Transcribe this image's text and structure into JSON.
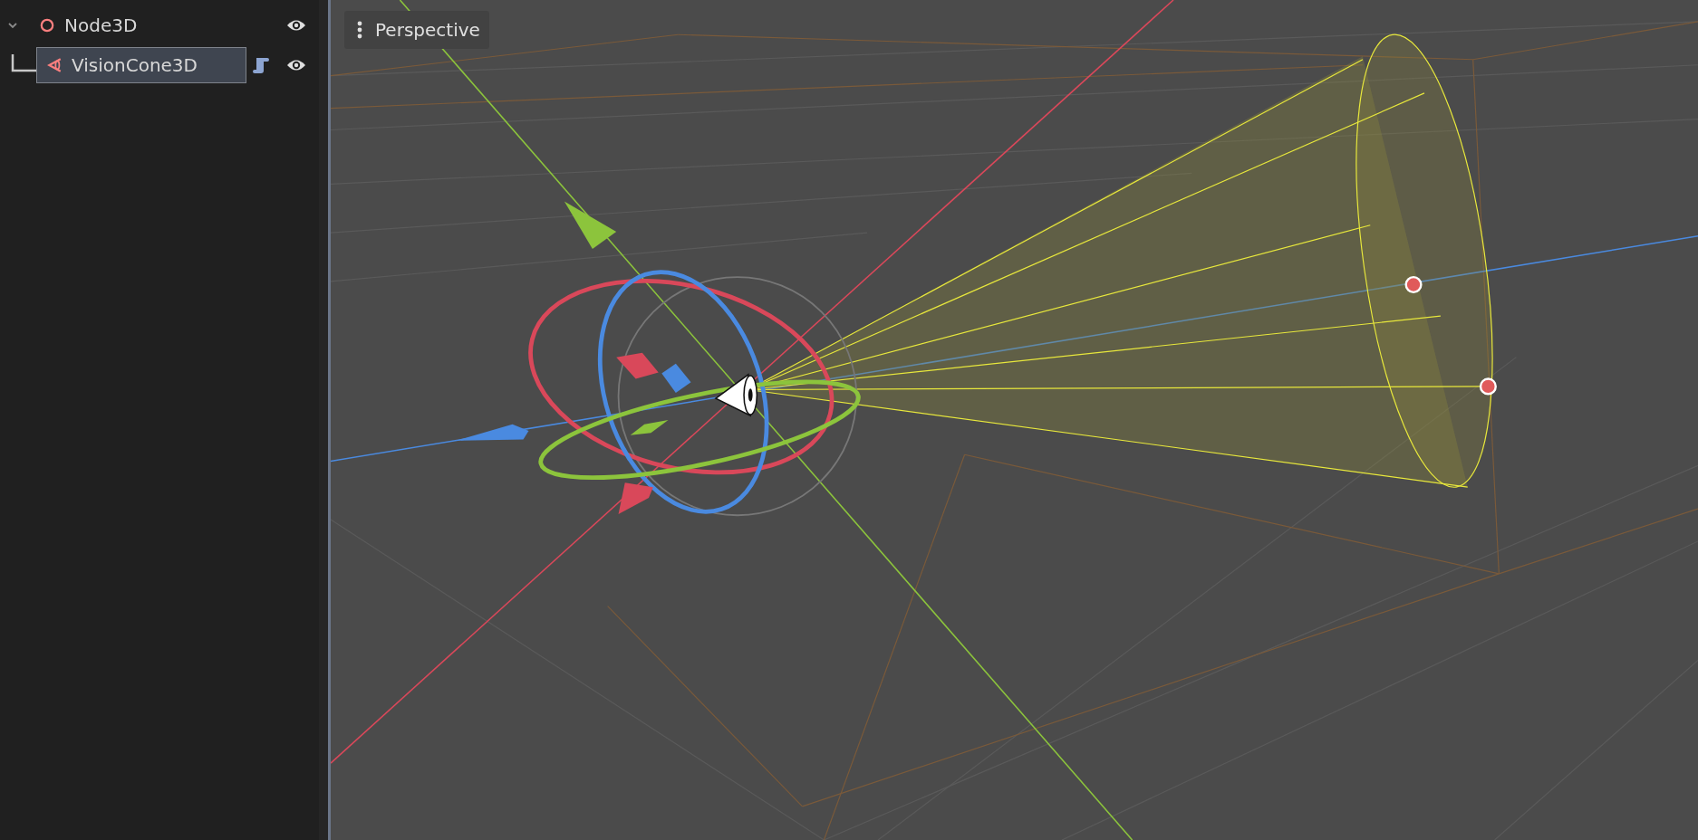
{
  "scene_tree": {
    "items": [
      {
        "name": "Node3D",
        "kind": "node3d",
        "expanded": true,
        "visible": true,
        "selected": false,
        "has_script": false,
        "children": [
          {
            "name": "VisionCone3D",
            "kind": "vision_cone",
            "visible": true,
            "selected": true,
            "has_script": true
          }
        ]
      }
    ]
  },
  "viewport": {
    "view_menu": {
      "label": "Perspective"
    }
  }
}
